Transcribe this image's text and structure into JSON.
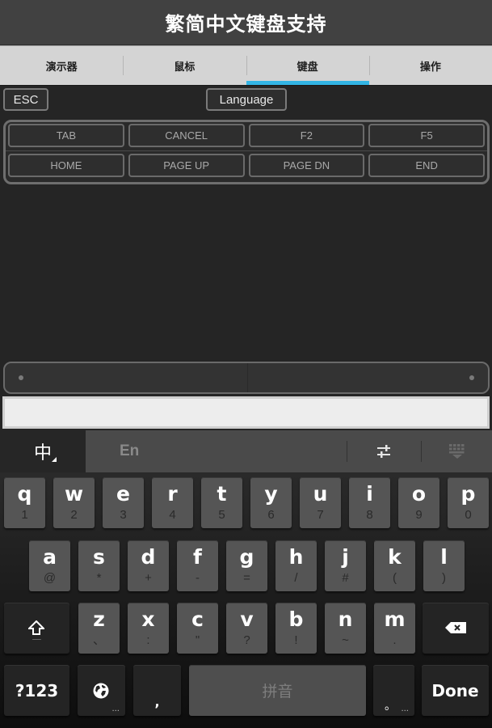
{
  "header": {
    "title": "繁简中文键盘支持"
  },
  "tabs": [
    {
      "label": "演示器",
      "active": false
    },
    {
      "label": "鼠标",
      "active": false
    },
    {
      "label": "键盘",
      "active": true
    },
    {
      "label": "操作",
      "active": false
    }
  ],
  "accent_color": "#33b5e5",
  "controls": {
    "esc_label": "ESC",
    "language_label": "Language"
  },
  "function_keys": {
    "row1": [
      "TAB",
      "CANCEL",
      "F2",
      "F5"
    ],
    "row2": [
      "HOME",
      "PAGE UP",
      "PAGE DN",
      "END"
    ]
  },
  "text_input": {
    "value": "",
    "placeholder": ""
  },
  "ime_bar": {
    "chinese_label": "中",
    "english_label": "En",
    "settings_icon": "sliders-icon",
    "hide_keyboard_icon": "keyboard-hide-icon"
  },
  "keyboard": {
    "row1": [
      {
        "main": "q",
        "sub": "1"
      },
      {
        "main": "w",
        "sub": "2"
      },
      {
        "main": "e",
        "sub": "3"
      },
      {
        "main": "r",
        "sub": "4"
      },
      {
        "main": "t",
        "sub": "5"
      },
      {
        "main": "y",
        "sub": "6"
      },
      {
        "main": "u",
        "sub": "7"
      },
      {
        "main": "i",
        "sub": "8"
      },
      {
        "main": "o",
        "sub": "9"
      },
      {
        "main": "p",
        "sub": "0"
      }
    ],
    "row2": [
      {
        "main": "a",
        "sub": "@"
      },
      {
        "main": "s",
        "sub": "*"
      },
      {
        "main": "d",
        "sub": "+"
      },
      {
        "main": "f",
        "sub": "-"
      },
      {
        "main": "g",
        "sub": "="
      },
      {
        "main": "h",
        "sub": "/"
      },
      {
        "main": "j",
        "sub": "#"
      },
      {
        "main": "k",
        "sub": "("
      },
      {
        "main": "l",
        "sub": ")"
      }
    ],
    "row3": [
      {
        "main": "z",
        "sub": "、"
      },
      {
        "main": "x",
        "sub": ":"
      },
      {
        "main": "c",
        "sub": "\""
      },
      {
        "main": "v",
        "sub": "?"
      },
      {
        "main": "b",
        "sub": "!"
      },
      {
        "main": "n",
        "sub": "~"
      },
      {
        "main": "m",
        "sub": "."
      }
    ],
    "shift_icon": "shift-arrow-icon",
    "shift_sub": "—",
    "backspace_icon": "backspace-icon",
    "symbols_label": "?123",
    "globe_icon": "globe-icon",
    "globe_more": "...",
    "comma_label": ",",
    "space_label": "拼音",
    "period_label": "。",
    "period_more": "...",
    "done_label": "Done"
  }
}
